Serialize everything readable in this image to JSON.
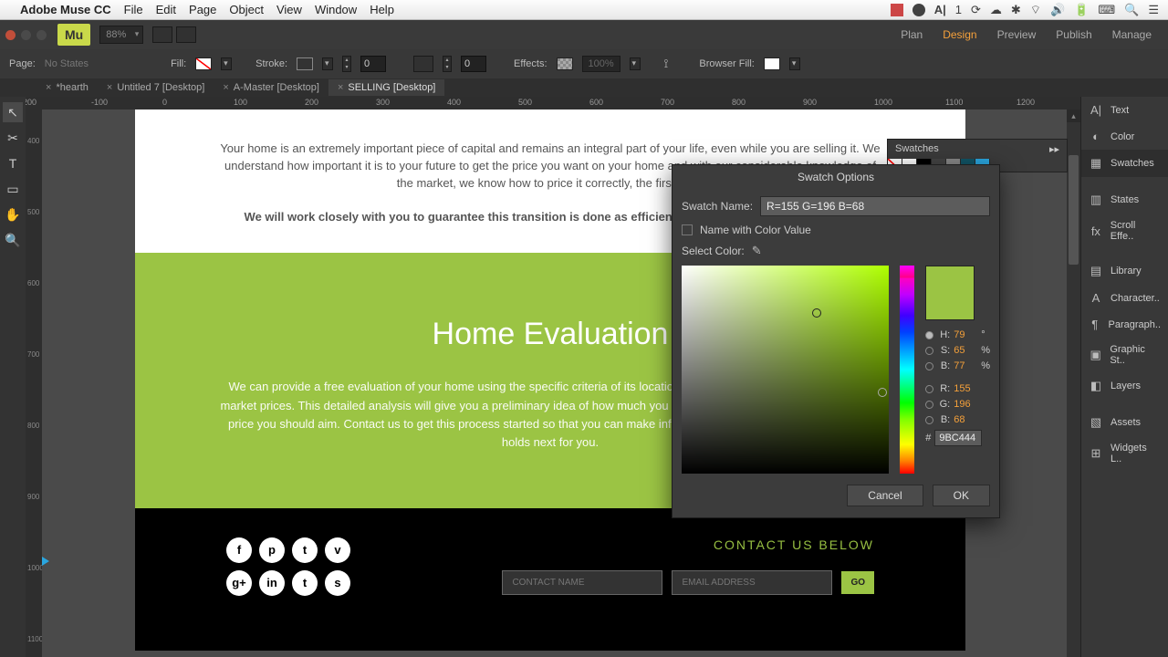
{
  "menubar": {
    "app": "Adobe Muse CC",
    "items": [
      "File",
      "Edit",
      "Page",
      "Object",
      "View",
      "Window",
      "Help"
    ],
    "right_adobe_count": "1"
  },
  "apptop": {
    "zoom": "88%",
    "modes": [
      "Plan",
      "Design",
      "Preview",
      "Publish",
      "Manage"
    ],
    "active_mode": "Design"
  },
  "controlbar": {
    "page_label": "Page:",
    "page_state": "No States",
    "fill_label": "Fill:",
    "stroke_label": "Stroke:",
    "stroke_val": "0",
    "corner_val": "0",
    "effects_label": "Effects:",
    "effects_val": "100%",
    "browserfill_label": "Browser Fill:"
  },
  "tabs": [
    {
      "label": "*hearth",
      "active": false
    },
    {
      "label": "Untitled 7 [Desktop]",
      "active": false
    },
    {
      "label": "A-Master [Desktop]",
      "active": false
    },
    {
      "label": "SELLING [Desktop]",
      "active": true
    }
  ],
  "ruler_marks": [
    -200,
    -100,
    0,
    100,
    200,
    300,
    400,
    500,
    600,
    700,
    800,
    900,
    1000,
    1100,
    1200
  ],
  "ruler_v": [
    400,
    500,
    600,
    700,
    800,
    900,
    1000,
    1100
  ],
  "right_panels": [
    "Text",
    "Color",
    "Swatches",
    "States",
    "Scroll Effe..",
    "Library",
    "Character..",
    "Paragraph..",
    "Graphic St..",
    "Layers",
    "Assets",
    "Widgets L.."
  ],
  "right_panel_active": "Swatches",
  "swatches_panel": {
    "title": "Swatches"
  },
  "page_content": {
    "intro1": "Your home is an extremely important piece of capital and remains an integral part of your life, even while you are selling it. We understand how important it is to your future to get the price you want on your home and with our considerable knowledge of the market, we know how to price it correctly, the first time.",
    "intro2": "We will work closely with you to guarantee this transition is done as efficiently and successfully as possible.",
    "green_title": "Home Evaluation",
    "green_body": "We can provide a free evaluation of your home using the specific criteria of its location and compare it with relevant current market prices. This detailed analysis will give you a preliminary idea of how much you can expect from the market and at what price you should aim. Contact us to get this process started so that you can make informed decisions about what the future holds next for you.",
    "contact_title": "CONTACT US BELOW",
    "contact_name_ph": "CONTACT NAME",
    "contact_email_ph": "EMAIL ADDRESS",
    "go": "GO",
    "social": [
      "f",
      "p",
      "t",
      "v",
      "g+",
      "in",
      "t",
      "s"
    ]
  },
  "dialog": {
    "title": "Swatch Options",
    "name_label": "Swatch Name:",
    "name_value": "R=155 G=196 B=68",
    "name_with_value": "Name with Color Value",
    "select_color": "Select Color:",
    "H": "79",
    "S": "65",
    "B": "77",
    "R": "155",
    "G": "196",
    "Bb": "68",
    "hex": "9BC444",
    "cancel": "Cancel",
    "ok": "OK"
  },
  "colors": {
    "accent": "#9bc444",
    "orange": "#f4a03a"
  },
  "chart_data": null
}
